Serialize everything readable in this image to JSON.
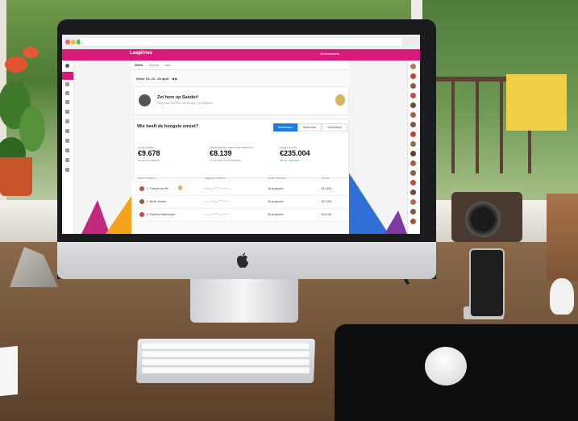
{
  "app": {
    "brand": "Leaplines",
    "header_user": "Medewerkers",
    "tabs": [
      {
        "label": "Week"
      },
      {
        "label": "Maand"
      },
      {
        "label": "Jaar"
      }
    ],
    "period": "Week 15: 23 - 30 april",
    "banner": {
      "title": "Zet hem op Sander!",
      "subtitle": "Nog maar €2.000 om de top 3 te behalen"
    },
    "question": "Wie heeft de hoogste omzet?",
    "scope_options": [
      {
        "label": "Amsterdam"
      },
      {
        "label": "Nederland"
      },
      {
        "label": "Wereldwijd"
      }
    ],
    "stats": [
      {
        "label": "JOUW OMZET",
        "value": "€9.678",
        "foot": "4% van jouw Maand"
      },
      {
        "label": "GEMIDDELDE OMZET PER PERSOON",
        "value": "€8.139",
        "foot": "+4.3% boven het gemiddelde"
      },
      {
        "label": "OMZET PLUNK",
        "value": "€235.004",
        "foot": "4% van Nederland"
      }
    ],
    "table_headers": [
      "Naam verkoper",
      "Afgelopen maand",
      "Aantal verkopen",
      "Omzet"
    ],
    "rows": [
      {
        "name": "1. Thomas de Wit",
        "sales": "45 producten",
        "revenue": "€13.200"
      },
      {
        "name": "2. Berlin Jansen",
        "sales": "40 producten",
        "revenue": "€12.004"
      },
      {
        "name": "3. Sabrina Oldenburger",
        "sales": "35 producten",
        "revenue": "€11.046"
      }
    ]
  },
  "colors": {
    "brand_pink": "#d81b7a",
    "accent_blue": "#1f7ae0",
    "positive_green": "#2e9d4a"
  }
}
